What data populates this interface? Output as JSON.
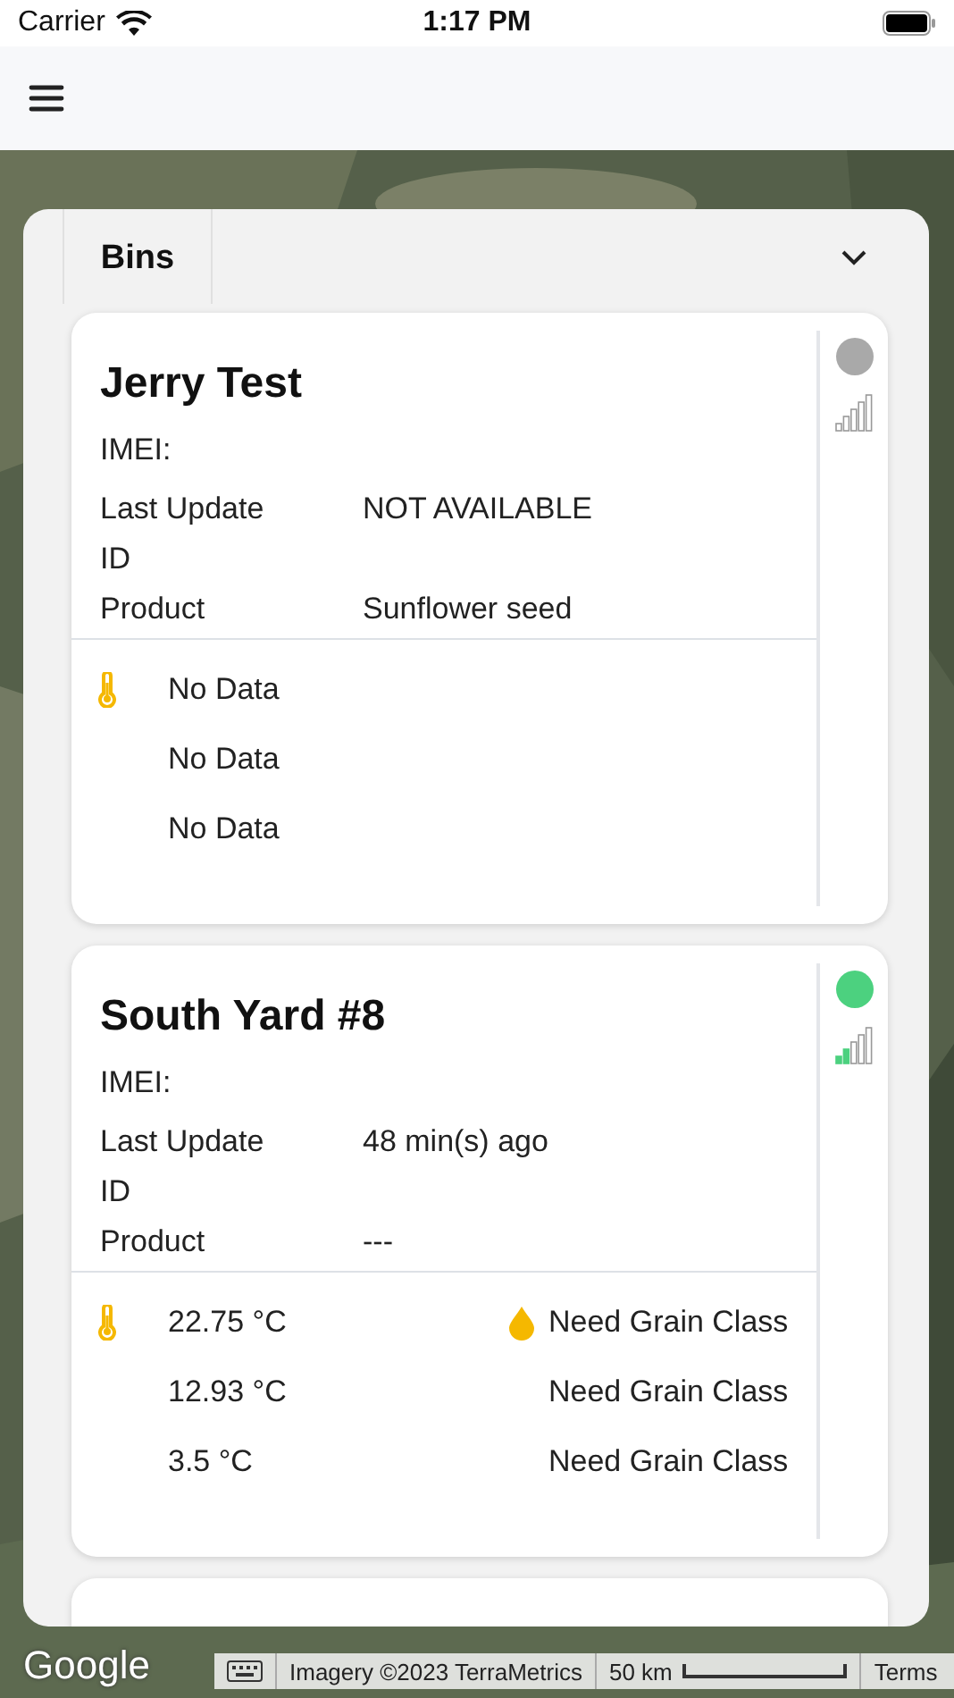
{
  "status_bar": {
    "carrier": "Carrier",
    "time": "1:17 PM"
  },
  "panel": {
    "tab": {
      "label": "Bins",
      "selected": true
    },
    "expanded": true
  },
  "bins": [
    {
      "name": "Jerry Test",
      "color": "#a9a9a9",
      "online": false,
      "fields": [
        {
          "label": "IMEI:"
        },
        {
          "label": "Last Update",
          "value": "NOT AVAILABLE"
        },
        {
          "label": "ID"
        },
        {
          "label": "Product",
          "value": "Sunflower seed"
        }
      ],
      "readings": [
        {
          "temperature": "No Data"
        },
        {
          "temperature": "No Data"
        },
        {
          "temperature": "No Data"
        }
      ]
    },
    {
      "name": "South Yard #8",
      "color": "#4cd17f",
      "online": true,
      "fields": [
        {
          "label": "IMEI:"
        },
        {
          "label": "Last Update",
          "value": "48 min(s) ago"
        },
        {
          "label": "ID"
        },
        {
          "label": "Product",
          "value": "---"
        }
      ],
      "readings": [
        {
          "temperature": "22.75 °C",
          "moisture": "Need Grain Class"
        },
        {
          "temperature": "12.93 °C",
          "moisture": "Need Grain Class"
        },
        {
          "temperature": "3.5 °C",
          "moisture": "Need Grain Class"
        }
      ]
    }
  ],
  "map_footer": {
    "logo": "Google",
    "attribution": "Imagery ©2023 TerraMetrics",
    "scale": "50 km",
    "terms": "Terms"
  }
}
